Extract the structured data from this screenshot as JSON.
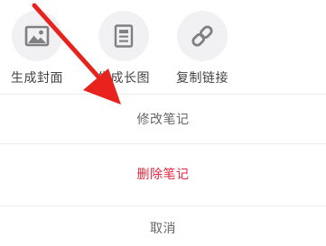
{
  "share": {
    "items": [
      {
        "label": "生成封面",
        "icon": "image-icon"
      },
      {
        "label": "生成长图",
        "icon": "document-icon"
      },
      {
        "label": "复制链接",
        "icon": "link-icon"
      }
    ]
  },
  "actions": {
    "edit_label": "修改笔记",
    "delete_label": "删除笔记",
    "cancel_label": "取消"
  },
  "colors": {
    "delete": "#e5293f",
    "secondary_text": "#666666",
    "icon_bg": "#f1f1f3",
    "icon": "#808080",
    "annotation_arrow": "#e8231e"
  }
}
